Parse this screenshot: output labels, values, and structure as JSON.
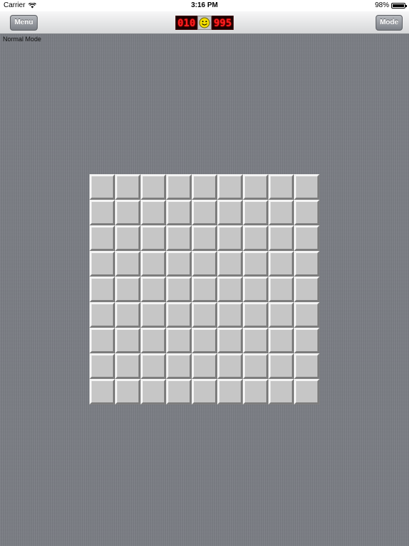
{
  "status_bar": {
    "carrier": "Carrier",
    "time": "3:16 PM",
    "battery": "98%",
    "icons": [
      "wifi-icon",
      "battery-icon"
    ]
  },
  "nav_bar": {
    "menu_label": "Menu",
    "mode_label": "Mode",
    "timer": "010",
    "mine_counter": "995",
    "smiley": "smiley-face-icon"
  },
  "mode_text": "Normal Mode",
  "board": {
    "rows": 9,
    "columns": 9,
    "cell_state": "unrevealed"
  },
  "colors": {
    "background": "#7b7e85",
    "cell": "#c6c6c6",
    "led_digits": "#ff2020",
    "smiley": "#f5e000"
  }
}
